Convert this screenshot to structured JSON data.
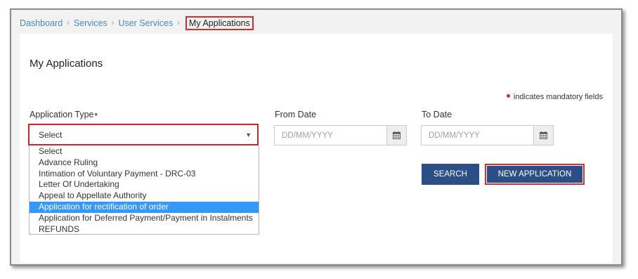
{
  "breadcrumb": {
    "items": [
      "Dashboard",
      "Services",
      "User Services"
    ],
    "current": "My Applications",
    "separator": "›"
  },
  "page": {
    "title": "My Applications",
    "mandatory_note": "indicates mandatory fields"
  },
  "form": {
    "application_type": {
      "label": "Application Type",
      "required_marker": "•",
      "selected": "Select",
      "options": [
        "Select",
        "Advance Ruling",
        "Intimation of Voluntary Payment - DRC-03",
        "Letter Of Undertaking",
        "Appeal to Appellate Authority",
        "Application for rectification of order",
        "Application for Deferred Payment/Payment in Instalments",
        "REFUNDS"
      ],
      "highlighted_option": "Application for rectification of order"
    },
    "from_date": {
      "label": "From Date",
      "placeholder": "DD/MM/YYYY",
      "value": ""
    },
    "to_date": {
      "label": "To Date",
      "placeholder": "DD/MM/YYYY",
      "value": ""
    }
  },
  "buttons": {
    "search": "SEARCH",
    "new_application": "NEW APPLICATION"
  },
  "icons": {
    "calendar": "calendar-icon",
    "caret": "caret-down-icon"
  },
  "colors": {
    "primary_button": "#2c4e86",
    "highlight_red": "#d32f2f",
    "selected_option": "#3399ff",
    "link": "#4a88c4"
  }
}
